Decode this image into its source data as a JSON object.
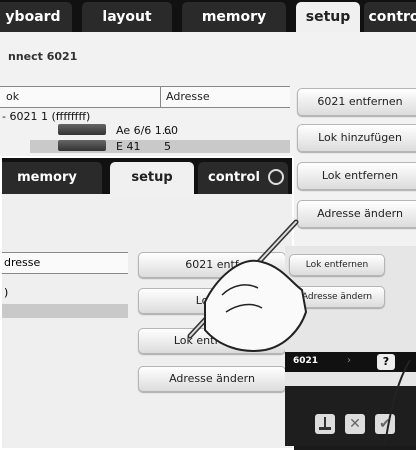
{
  "layer1": {
    "tabs": [
      {
        "label": "yboard"
      },
      {
        "label": "layout"
      },
      {
        "label": "memory"
      },
      {
        "label": "setup",
        "active": true
      },
      {
        "label": "contro"
      }
    ],
    "connect_title": "nnect 6021",
    "table": {
      "col_lok": "ok",
      "col_adresse": "Adresse",
      "root": "6021 1 (ffffffff)",
      "rows": [
        {
          "name": "Ae 6/6 1...",
          "adresse": "60"
        },
        {
          "name": "E 41",
          "adresse": "5",
          "selected": true
        }
      ]
    },
    "buttons": {
      "remove_6021": "6021 entfernen",
      "add_lok": "Lok hinzufügen",
      "remove_lok": "Lok entfernen",
      "change_address": "Adresse ändern"
    }
  },
  "layer2": {
    "tabs": [
      {
        "label": "memory"
      },
      {
        "label": "setup",
        "active": true
      },
      {
        "label": "control"
      }
    ],
    "col_adresse": "dresse",
    "row_value": ")",
    "buttons": {
      "remove_6021": "6021 entf",
      "add_lok": "Lok hi",
      "remove_lok": "Lok entfernen",
      "change_address": "Adresse ändern"
    }
  },
  "layer3": {
    "buttons": {
      "remove_lok": "Lok entfernen",
      "change_address": "Adresse ändern"
    },
    "status": {
      "device": "6021",
      "help": "?"
    },
    "toolbar": {
      "check": "✔",
      "close": "✕"
    }
  },
  "colors": {
    "dark_bar": "#111111",
    "panel": "#f2f2f2",
    "selected_row": "#c9c9c9"
  }
}
